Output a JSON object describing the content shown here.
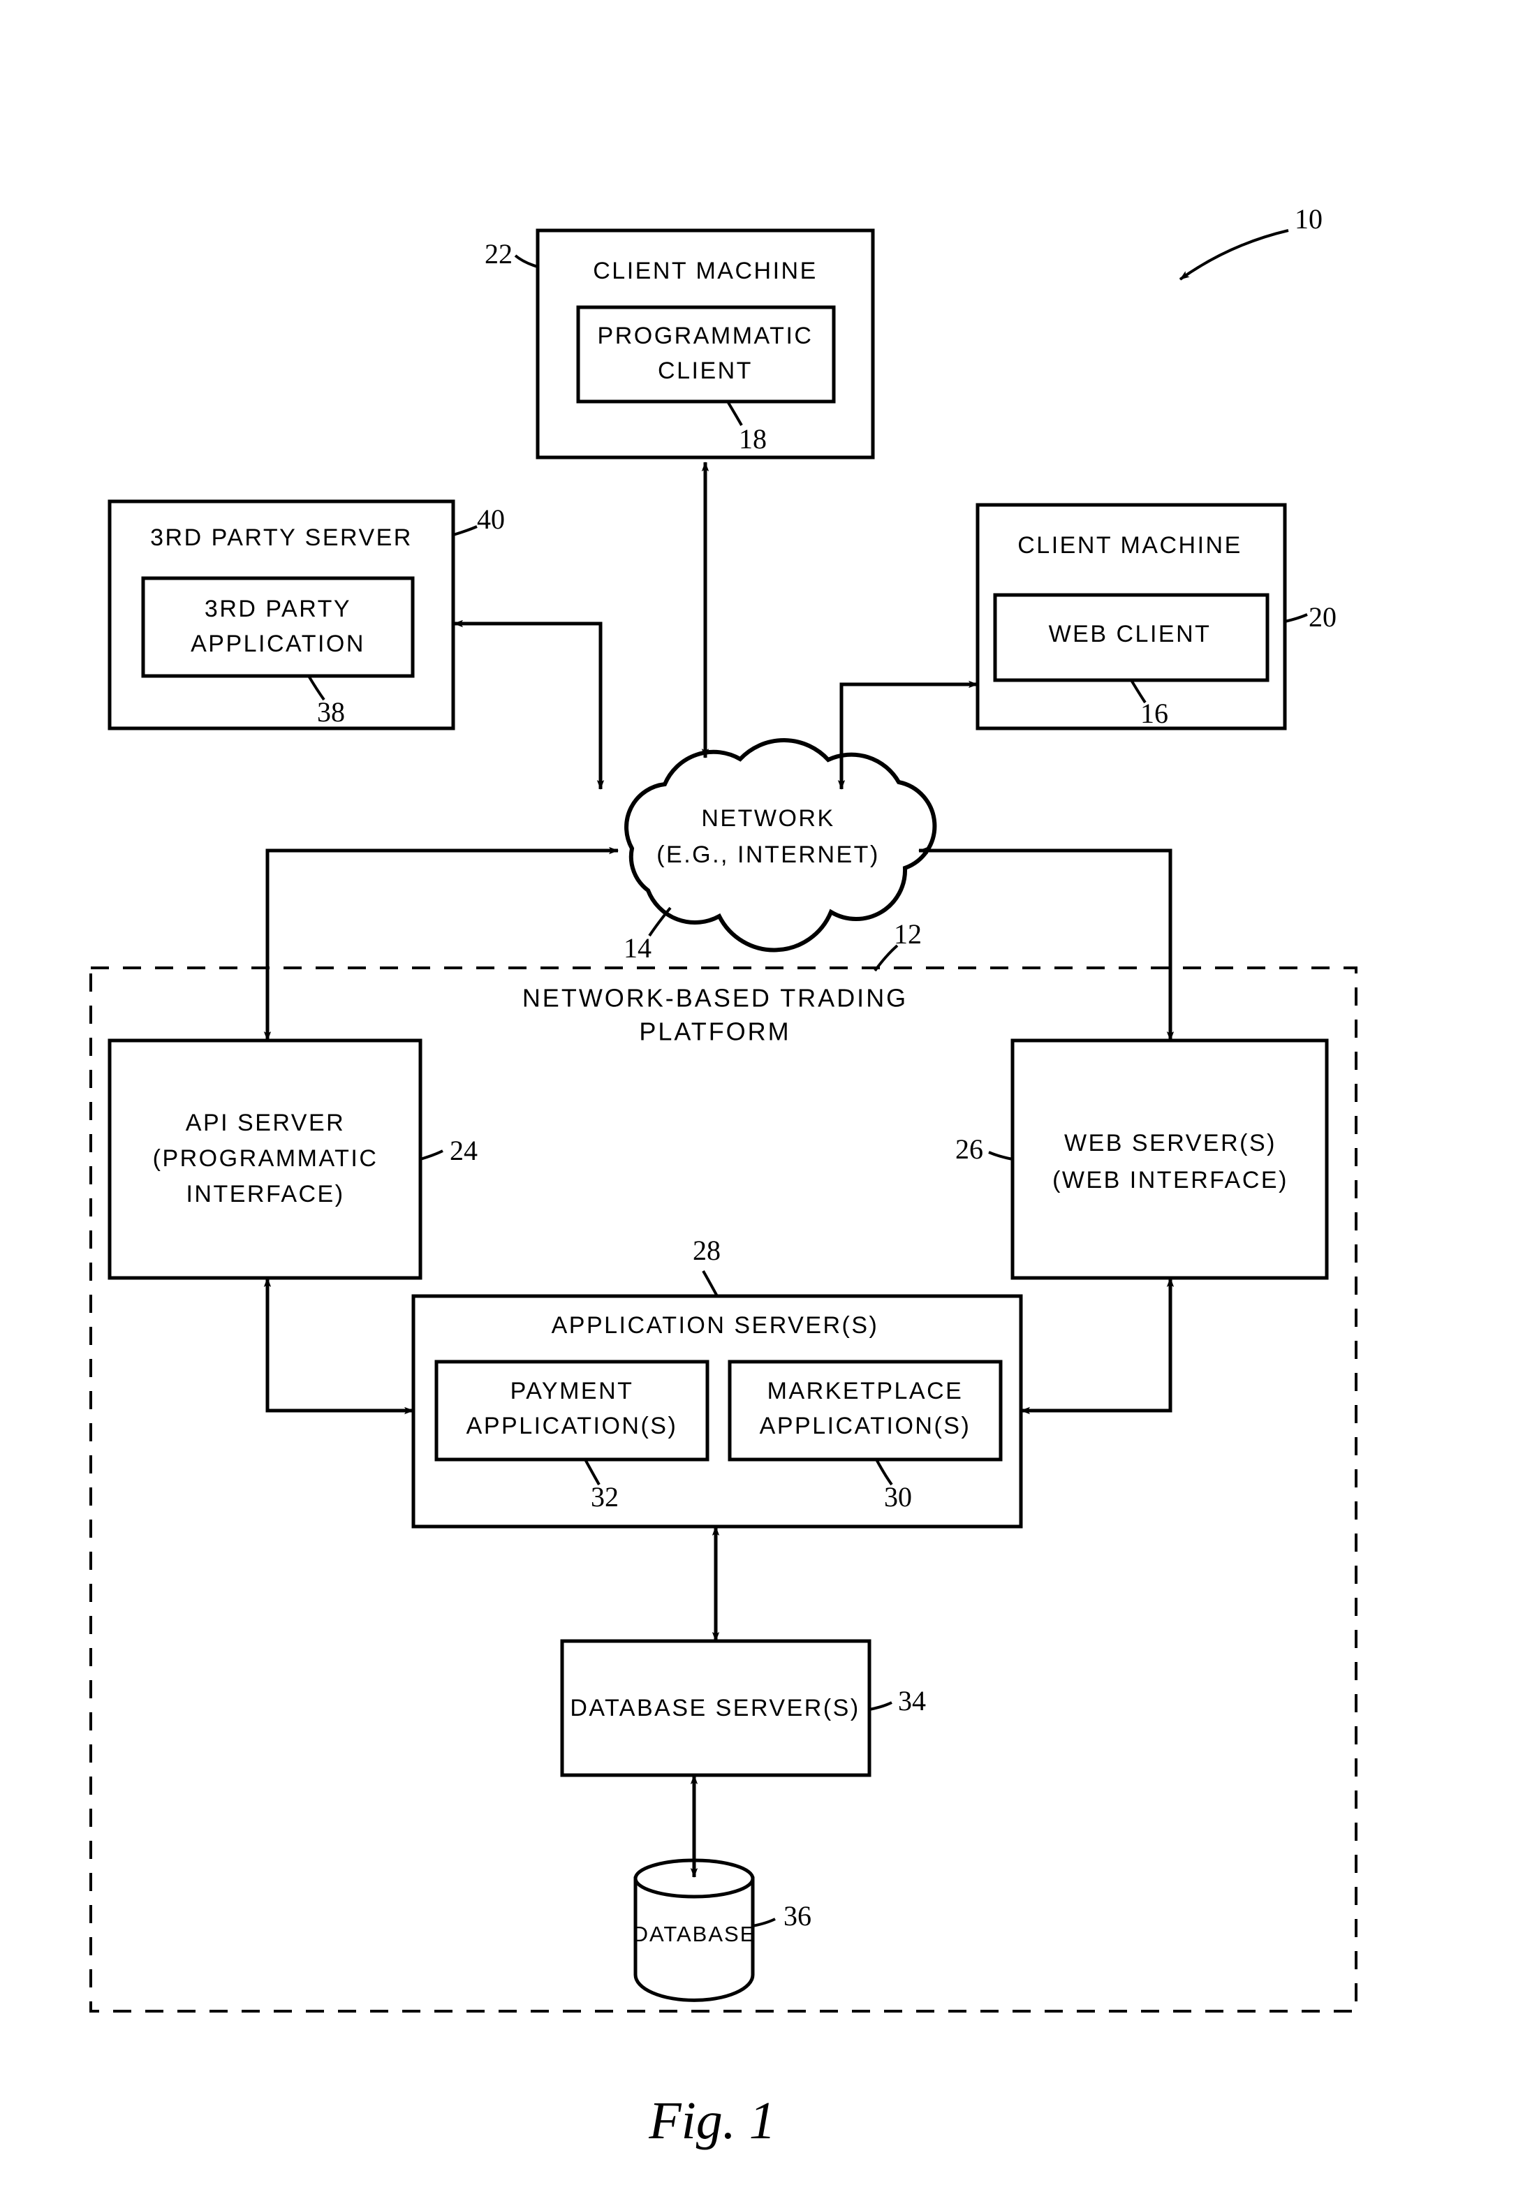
{
  "figure": {
    "caption": "Fig. 1",
    "system_ref": "10"
  },
  "nodes": {
    "client_machine_programmatic": {
      "title": "CLIENT MACHINE",
      "ref": "22",
      "inner": {
        "line1": "PROGRAMMATIC",
        "line2": "CLIENT",
        "ref": "18"
      }
    },
    "third_party_server": {
      "title": "3RD PARTY SERVER",
      "ref": "40",
      "inner": {
        "line1": "3RD PARTY",
        "line2": "APPLICATION",
        "ref": "38"
      }
    },
    "client_machine_web": {
      "title": "CLIENT MACHINE",
      "ref": "20",
      "inner": {
        "line1": "WEB CLIENT",
        "ref": "16"
      }
    },
    "network": {
      "line1": "NETWORK",
      "line2": "(E.G., INTERNET)",
      "ref": "14"
    },
    "platform": {
      "line1": "NETWORK-BASED TRADING",
      "line2": "PLATFORM",
      "ref": "12"
    },
    "api_server": {
      "line1": "API SERVER",
      "line2": "(PROGRAMMATIC",
      "line3": "INTERFACE)",
      "ref": "24"
    },
    "web_server": {
      "line1": "WEB SERVER(S)",
      "line2": "(WEB INTERFACE)",
      "ref": "26"
    },
    "application_server": {
      "title": "APPLICATION SERVER(S)",
      "ref": "28",
      "payment": {
        "line1": "PAYMENT",
        "line2": "APPLICATION(S)",
        "ref": "32"
      },
      "marketplace": {
        "line1": "MARKETPLACE",
        "line2": "APPLICATION(S)",
        "ref": "30"
      }
    },
    "database_server": {
      "title": "DATABASE SERVER(S)",
      "ref": "34"
    },
    "database": {
      "title": "DATABASE",
      "ref": "36"
    }
  },
  "colors": {
    "ink": "#000000",
    "paper": "#ffffff"
  }
}
